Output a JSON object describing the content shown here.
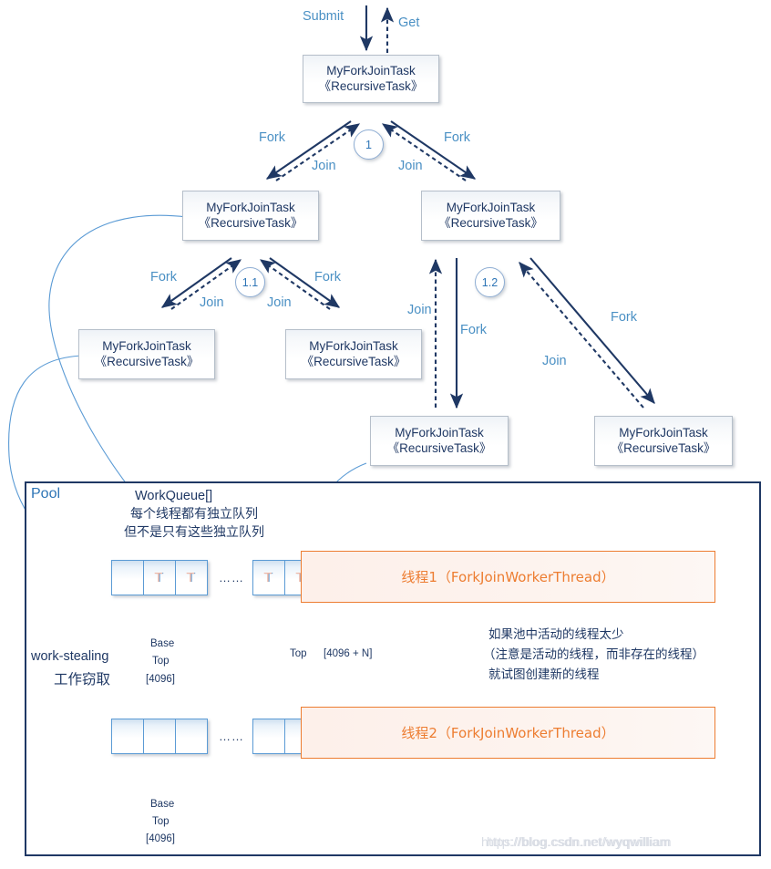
{
  "diagram": {
    "title_pool": "Pool",
    "task_label_line1": "MyForkJoinTask",
    "task_label_line2": "《RecursiveTask》",
    "colors": {
      "task_text": "#1f3864",
      "arrow_dark": "#1f3864",
      "label_blue": "#4a90c4",
      "thread_orange": "#ed7d31",
      "pool_border": "#1f3864",
      "cell_border": "#5b9bd5"
    }
  },
  "top_arrows": {
    "submit": "Submit",
    "get": "Get"
  },
  "tasks": [
    {
      "id": "root",
      "line1": "MyForkJoinTask",
      "line2": "《RecursiveTask》"
    },
    {
      "id": "l1",
      "line1": "MyForkJoinTask",
      "line2": "《RecursiveTask》"
    },
    {
      "id": "r1",
      "line1": "MyForkJoinTask",
      "line2": "《RecursiveTask》"
    },
    {
      "id": "l1a",
      "line1": "MyForkJoinTask",
      "line2": "《RecursiveTask》"
    },
    {
      "id": "l1b",
      "line1": "MyForkJoinTask",
      "line2": "《RecursiveTask》"
    },
    {
      "id": "r1a",
      "line1": "MyForkJoinTask",
      "line2": "《RecursiveTask》"
    },
    {
      "id": "r1b",
      "line1": "MyForkJoinTask",
      "line2": "《RecursiveTask》"
    }
  ],
  "steps": [
    {
      "id": "step-1",
      "label": "1"
    },
    {
      "id": "step-1-1",
      "label": "1.1"
    },
    {
      "id": "step-1-2",
      "label": "1.2"
    }
  ],
  "edge_labels": {
    "fork": "Fork",
    "join": "Join"
  },
  "pool": {
    "queue_header": "WorkQueue[]",
    "queue_note_line1": "每个线程都有独立队列",
    "queue_note_line2": "但不是只有这些独立队列",
    "work_stealing_en": "work-stealing",
    "work_stealing_cn": "工作窃取",
    "base_label": "Base",
    "top_label": "Top",
    "index_4096": "[4096]",
    "top_right_label": "Top",
    "index_4096_n": "[4096 + N]",
    "cell_token": "T",
    "ellipsis": "……",
    "thread1": "线程1（ForkJoinWorkerThread）",
    "thread2": "线程2（ForkJoinWorkerThread）",
    "grow_note_line1": "如果池中活动的线程太少",
    "grow_note_line2": "（注意是活动的线程，而非存在的线程）",
    "grow_note_line3": "就试图创建新的线程",
    "base2_label": "Base",
    "top2_label": "Top",
    "index2_4096": "[4096]"
  },
  "watermark": {
    "text_a": "https://blog.csdn.net/wyqwilliam",
    "text_b": "http://blog.csdn.net/wyqwilliam"
  }
}
